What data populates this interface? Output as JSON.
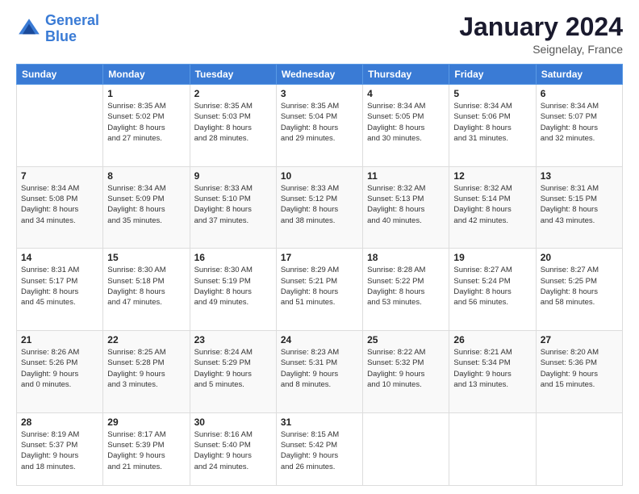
{
  "header": {
    "logo_line1": "General",
    "logo_line2": "Blue",
    "title": "January 2024",
    "subtitle": "Seignelay, France"
  },
  "days_of_week": [
    "Sunday",
    "Monday",
    "Tuesday",
    "Wednesday",
    "Thursday",
    "Friday",
    "Saturday"
  ],
  "weeks": [
    [
      {
        "day": "",
        "info": ""
      },
      {
        "day": "1",
        "info": "Sunrise: 8:35 AM\nSunset: 5:02 PM\nDaylight: 8 hours\nand 27 minutes."
      },
      {
        "day": "2",
        "info": "Sunrise: 8:35 AM\nSunset: 5:03 PM\nDaylight: 8 hours\nand 28 minutes."
      },
      {
        "day": "3",
        "info": "Sunrise: 8:35 AM\nSunset: 5:04 PM\nDaylight: 8 hours\nand 29 minutes."
      },
      {
        "day": "4",
        "info": "Sunrise: 8:34 AM\nSunset: 5:05 PM\nDaylight: 8 hours\nand 30 minutes."
      },
      {
        "day": "5",
        "info": "Sunrise: 8:34 AM\nSunset: 5:06 PM\nDaylight: 8 hours\nand 31 minutes."
      },
      {
        "day": "6",
        "info": "Sunrise: 8:34 AM\nSunset: 5:07 PM\nDaylight: 8 hours\nand 32 minutes."
      }
    ],
    [
      {
        "day": "7",
        "info": ""
      },
      {
        "day": "8",
        "info": "Sunrise: 8:34 AM\nSunset: 5:09 PM\nDaylight: 8 hours\nand 35 minutes."
      },
      {
        "day": "9",
        "info": "Sunrise: 8:33 AM\nSunset: 5:10 PM\nDaylight: 8 hours\nand 37 minutes."
      },
      {
        "day": "10",
        "info": "Sunrise: 8:33 AM\nSunset: 5:12 PM\nDaylight: 8 hours\nand 38 minutes."
      },
      {
        "day": "11",
        "info": "Sunrise: 8:32 AM\nSunset: 5:13 PM\nDaylight: 8 hours\nand 40 minutes."
      },
      {
        "day": "12",
        "info": "Sunrise: 8:32 AM\nSunset: 5:14 PM\nDaylight: 8 hours\nand 42 minutes."
      },
      {
        "day": "13",
        "info": "Sunrise: 8:31 AM\nSunset: 5:15 PM\nDaylight: 8 hours\nand 43 minutes."
      }
    ],
    [
      {
        "day": "14",
        "info": ""
      },
      {
        "day": "15",
        "info": "Sunrise: 8:30 AM\nSunset: 5:18 PM\nDaylight: 8 hours\nand 47 minutes."
      },
      {
        "day": "16",
        "info": "Sunrise: 8:30 AM\nSunset: 5:19 PM\nDaylight: 8 hours\nand 49 minutes."
      },
      {
        "day": "17",
        "info": "Sunrise: 8:29 AM\nSunset: 5:21 PM\nDaylight: 8 hours\nand 51 minutes."
      },
      {
        "day": "18",
        "info": "Sunrise: 8:28 AM\nSunset: 5:22 PM\nDaylight: 8 hours\nand 53 minutes."
      },
      {
        "day": "19",
        "info": "Sunrise: 8:27 AM\nSunset: 5:24 PM\nDaylight: 8 hours\nand 56 minutes."
      },
      {
        "day": "20",
        "info": "Sunrise: 8:27 AM\nSunset: 5:25 PM\nDaylight: 8 hours\nand 58 minutes."
      }
    ],
    [
      {
        "day": "21",
        "info": ""
      },
      {
        "day": "22",
        "info": "Sunrise: 8:25 AM\nSunset: 5:28 PM\nDaylight: 9 hours\nand 3 minutes."
      },
      {
        "day": "23",
        "info": "Sunrise: 8:24 AM\nSunset: 5:29 PM\nDaylight: 9 hours\nand 5 minutes."
      },
      {
        "day": "24",
        "info": "Sunrise: 8:23 AM\nSunset: 5:31 PM\nDaylight: 9 hours\nand 8 minutes."
      },
      {
        "day": "25",
        "info": "Sunrise: 8:22 AM\nSunset: 5:32 PM\nDaylight: 9 hours\nand 10 minutes."
      },
      {
        "day": "26",
        "info": "Sunrise: 8:21 AM\nSunset: 5:34 PM\nDaylight: 9 hours\nand 13 minutes."
      },
      {
        "day": "27",
        "info": "Sunrise: 8:20 AM\nSunset: 5:36 PM\nDaylight: 9 hours\nand 15 minutes."
      }
    ],
    [
      {
        "day": "28",
        "info": ""
      },
      {
        "day": "29",
        "info": "Sunrise: 8:17 AM\nSunset: 5:39 PM\nDaylight: 9 hours\nand 21 minutes."
      },
      {
        "day": "30",
        "info": "Sunrise: 8:16 AM\nSunset: 5:40 PM\nDaylight: 9 hours\nand 24 minutes."
      },
      {
        "day": "31",
        "info": "Sunrise: 8:15 AM\nSunset: 5:42 PM\nDaylight: 9 hours\nand 26 minutes."
      },
      {
        "day": "",
        "info": ""
      },
      {
        "day": "",
        "info": ""
      },
      {
        "day": "",
        "info": ""
      }
    ]
  ],
  "week1_special": [
    {
      "day": "7",
      "info": "Sunrise: 8:34 AM\nSunset: 5:08 PM\nDaylight: 8 hours\nand 34 minutes."
    }
  ],
  "week3_special": [
    {
      "day": "14",
      "info": "Sunrise: 8:31 AM\nSunset: 5:17 PM\nDaylight: 8 hours\nand 45 minutes."
    }
  ],
  "week4_special": [
    {
      "day": "21",
      "info": "Sunrise: 8:26 AM\nSunset: 5:26 PM\nDaylight: 9 hours\nand 0 minutes."
    }
  ],
  "week5_special": [
    {
      "day": "28",
      "info": "Sunrise: 8:19 AM\nSunset: 5:37 PM\nDaylight: 9 hours\nand 18 minutes."
    }
  ]
}
